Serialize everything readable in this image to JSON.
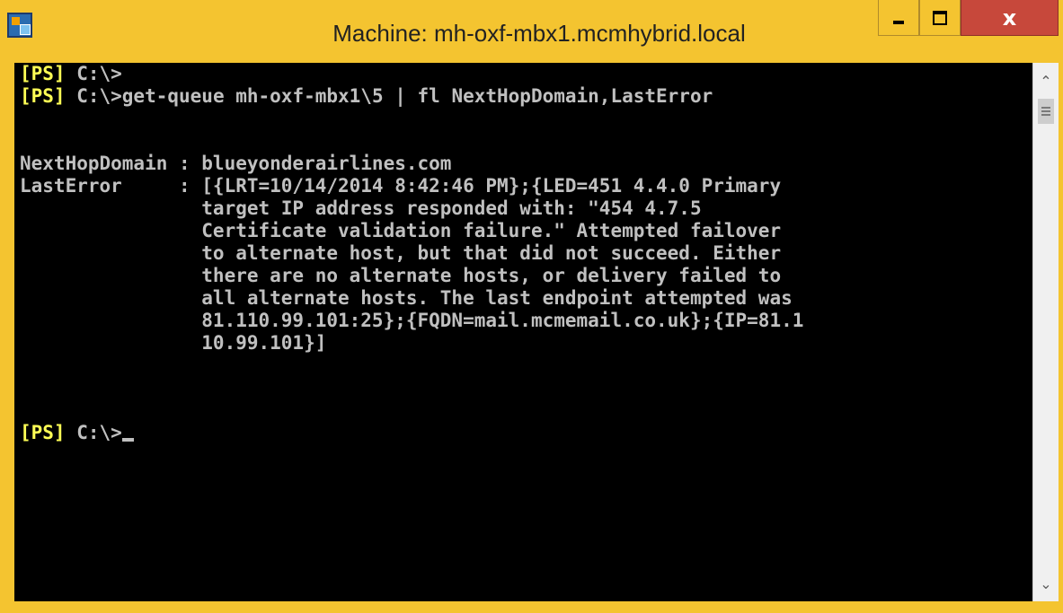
{
  "window": {
    "title": "Machine: mh-oxf-mbx1.mcmhybrid.local",
    "controls": {
      "minimize": "_",
      "maximize": "□",
      "close": "x"
    }
  },
  "console": {
    "prompt_tag": "[PS]",
    "lines": [
      {
        "tag": "[PS]",
        "text": " C:\\>"
      },
      {
        "tag": "[PS]",
        "text": " C:\\>get-queue mh-oxf-mbx1\\5 | fl NextHopDomain,LastError"
      },
      {
        "tag": "",
        "text": ""
      },
      {
        "tag": "",
        "text": ""
      },
      {
        "tag": "",
        "text": "NextHopDomain : blueyonderairlines.com"
      },
      {
        "tag": "",
        "text": "LastError     : [{LRT=10/14/2014 8:42:46 PM};{LED=451 4.4.0 Primary"
      },
      {
        "tag": "",
        "text": "                target IP address responded with: \"454 4.7.5"
      },
      {
        "tag": "",
        "text": "                Certificate validation failure.\" Attempted failover"
      },
      {
        "tag": "",
        "text": "                to alternate host, but that did not succeed. Either"
      },
      {
        "tag": "",
        "text": "                there are no alternate hosts, or delivery failed to"
      },
      {
        "tag": "",
        "text": "                all alternate hosts. The last endpoint attempted was"
      },
      {
        "tag": "",
        "text": "                81.110.99.101:25};{FQDN=mail.mcmemail.co.uk};{IP=81.1"
      },
      {
        "tag": "",
        "text": "                10.99.101}]"
      },
      {
        "tag": "",
        "text": ""
      },
      {
        "tag": "",
        "text": ""
      },
      {
        "tag": "",
        "text": ""
      },
      {
        "tag": "[PS]",
        "text": " C:\\>"
      }
    ],
    "colors": {
      "background": "#000000",
      "text": "#C0C0C0",
      "prompt": "#FFFF55"
    }
  },
  "scrollbar": {
    "up_icon": "chevron-up-icon",
    "down_icon": "chevron-down-icon"
  },
  "chrome_color": "#F4C430"
}
